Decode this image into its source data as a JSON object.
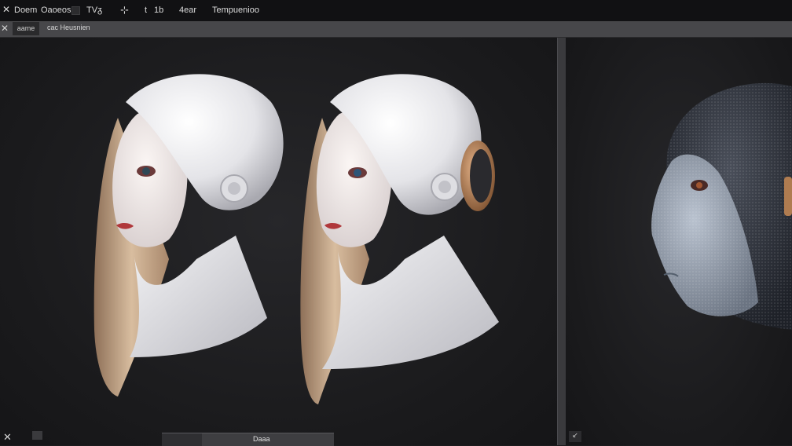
{
  "menubar": {
    "close_glyph": "✕",
    "items": [
      {
        "label": "Doem"
      },
      {
        "label": "Oaoeos"
      },
      {
        "label": "TVᵹ"
      },
      {
        "label": "⊹"
      },
      {
        "label": "t"
      },
      {
        "label": "1b"
      },
      {
        "label": "4ear"
      },
      {
        "label": "Tempuenioo"
      }
    ]
  },
  "toolbar": {
    "close_glyph": "✕",
    "tab_active": "aame",
    "tab_label": "cac Heusnien"
  },
  "viewport_left": {
    "models": [
      {
        "name": "head-a",
        "has_headphone": false
      },
      {
        "name": "head-b",
        "has_headphone": true
      }
    ]
  },
  "viewport_right": {
    "model": {
      "name": "head-c",
      "material": "dark knit"
    }
  },
  "bottom": {
    "tab_label": "Daaa",
    "left_glyph": "✕",
    "right_glyph": "↙"
  },
  "colors": {
    "background": "#1c1c1e",
    "menubar": "#111113",
    "toolbar": "#47474a",
    "splitter": "#3a3a3d",
    "head_white": "#e9e9ec",
    "hair": "#c9a98a",
    "headphone_copper": "#b07c50",
    "dark_hood": "#2b2f38"
  }
}
